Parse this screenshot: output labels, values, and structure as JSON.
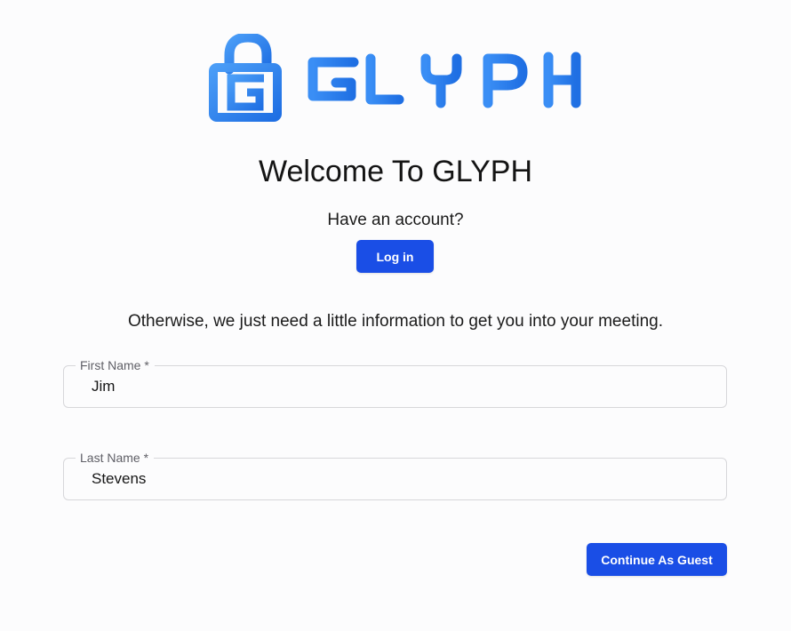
{
  "brand": {
    "name": "GLYPH",
    "logo_icon": "lock-g-icon",
    "colors": {
      "primary": "#1a4ee6",
      "logo_light": "#4a9df7",
      "logo_dark": "#1f6fe3"
    }
  },
  "welcome": {
    "title": "Welcome To GLYPH",
    "have_account": "Have an account?",
    "login_label": "Log in"
  },
  "info_text": "Otherwise, we just need a little information to get you into your meeting.",
  "form": {
    "first_name": {
      "label": "First Name *",
      "value": "Jim"
    },
    "last_name": {
      "label": "Last Name *",
      "value": "Stevens"
    },
    "submit_label": "Continue As Guest"
  }
}
